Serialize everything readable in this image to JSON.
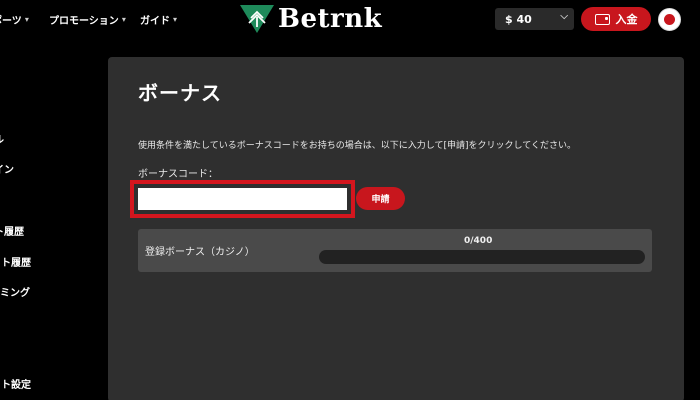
{
  "header": {
    "nav": [
      {
        "label": "ポーツ"
      },
      {
        "label": "プロモーション"
      },
      {
        "label": "ガイド"
      }
    ],
    "logo_text": "Betrnk",
    "balance": "$ 40",
    "deposit_label": "入金"
  },
  "sidebar": {
    "items": [
      {
        "label": "ル"
      },
      {
        "label": "イン"
      },
      {
        "label": "ト履歴"
      },
      {
        "label": "ット履歴"
      },
      {
        "label": "ーミング"
      },
      {
        "label": "ット設定"
      }
    ]
  },
  "main": {
    "title": "ボーナス",
    "description": "使用条件を満たしているボーナスコードをお持ちの場合は、以下に入力して[申請]をクリックしてください。",
    "code_label": "ボーナスコード：",
    "code_value": "",
    "apply_label": "申請",
    "bonus": {
      "label": "登録ボーナス（カジノ）",
      "progress_text": "0/400",
      "progress_current": 0,
      "progress_total": 400
    }
  },
  "colors": {
    "accent": "#c8161d",
    "panel": "#2f2f2f",
    "row": "#4a4a4a",
    "logo_green": "#1e8a5a"
  }
}
